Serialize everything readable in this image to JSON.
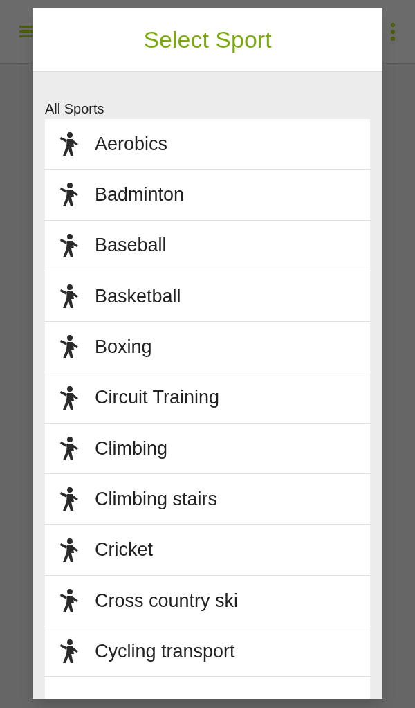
{
  "dialog": {
    "title": "Select Sport",
    "section": "All Sports",
    "sports": [
      {
        "label": "Aerobics"
      },
      {
        "label": "Badminton"
      },
      {
        "label": "Baseball"
      },
      {
        "label": "Basketball"
      },
      {
        "label": "Boxing"
      },
      {
        "label": "Circuit Training"
      },
      {
        "label": "Climbing"
      },
      {
        "label": "Climbing stairs"
      },
      {
        "label": "Cricket"
      },
      {
        "label": "Cross country ski"
      },
      {
        "label": "Cycling transport"
      }
    ]
  }
}
